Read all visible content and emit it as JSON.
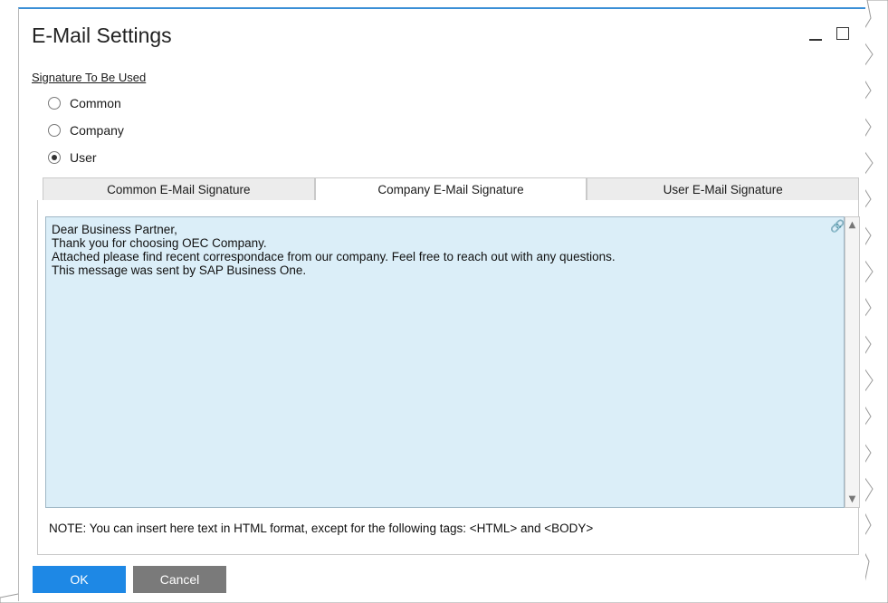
{
  "window": {
    "title": "E-Mail Settings"
  },
  "signature_group": {
    "label": "Signature To Be Used",
    "options": [
      {
        "label": "Common",
        "selected": false
      },
      {
        "label": "Company",
        "selected": false
      },
      {
        "label": "User",
        "selected": true
      }
    ]
  },
  "tabs": [
    {
      "label": "Common E-Mail Signature",
      "active": false
    },
    {
      "label": "Company E-Mail Signature",
      "active": true
    },
    {
      "label": "User E-Mail Signature",
      "active": false
    }
  ],
  "editor": {
    "lines": [
      "Dear Business Partner,",
      "Thank you for choosing OEC Company.",
      "Attached please find recent correspondace from our company. Feel free to reach out with any questions.",
      "This message was sent by SAP Business One."
    ]
  },
  "note": "NOTE: You can insert here text in HTML format, except for the following tags: <HTML> and <BODY>",
  "buttons": {
    "ok": "OK",
    "cancel": "Cancel"
  },
  "colors": {
    "editor_bg": "#dbeef8",
    "ok_button": "#1e88e5",
    "cancel_button": "#7a7a7a",
    "title_accent": "#3a8fd6"
  },
  "icons": [
    "minimize-icon",
    "maximize-icon",
    "hyperlink-icon",
    "scroll-up-icon",
    "scroll-down-icon"
  ]
}
